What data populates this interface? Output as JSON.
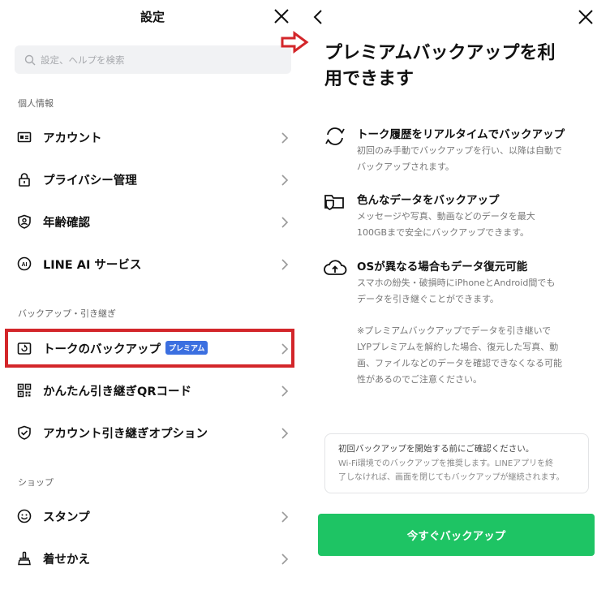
{
  "settings": {
    "title": "設定",
    "search_placeholder": "設定、ヘルプを検索",
    "sections": {
      "personal": "個人情報",
      "backup": "バックアップ・引き継ぎ",
      "shop": "ショップ"
    },
    "items": {
      "account": "アカウント",
      "privacy": "プライバシー管理",
      "age": "年齢確認",
      "lineai": "LINE AI サービス",
      "talk_backup": "トークのバックアップ",
      "talk_backup_badge": "プレミアム",
      "qr_transfer": "かんたん引き継ぎQRコード",
      "transfer_options": "アカウント引き継ぎオプション",
      "stamp": "スタンプ",
      "theme": "着せかえ"
    }
  },
  "premium": {
    "heading_line1": "プレミアムバックアップを利",
    "heading_line2": "用できます",
    "features": [
      {
        "title": "トーク履歴をリアルタイムでバックアップ",
        "desc_line1": "初回のみ手動でバックアップを行い、以降は自動で",
        "desc_line2": "バックアップされます。"
      },
      {
        "title": "色んなデータをバックアップ",
        "desc_line1": "メッセージや写真、動画などのデータを最大",
        "desc_line2": "100GBまで安全にバックアップできます。"
      },
      {
        "title": "OSが異なる場合もデータ復元可能",
        "desc_line1": "スマホの紛失・破損時にiPhoneとAndroid間でも",
        "desc_line2": "データを引き継ぐことができます。"
      }
    ],
    "note_line1": "※プレミアムバックアップでデータを引き継いで",
    "note_line2": "LYPプレミアムを解約した場合、復元した写真、動",
    "note_line3": "画、ファイルなどのデータを確認できなくなる可能",
    "note_line4": "性があるのでご注意ください。",
    "info_title": "初回バックアップを開始する前にご確認ください。",
    "info_line1": "Wi-Fi環境でのバックアップを推奨します。LINEアプリを終",
    "info_line2": "了しなければ、画面を閉じてもバックアップが継続されます。",
    "cta_label": "今すぐバックアップ"
  },
  "colors": {
    "accent_green": "#1ec464",
    "badge_blue": "#3b6fe0",
    "highlight_red": "#d3262a"
  }
}
